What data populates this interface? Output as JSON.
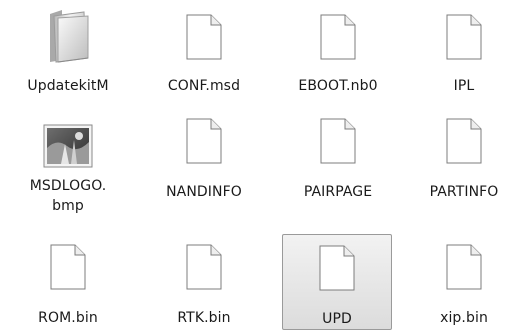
{
  "files": [
    {
      "name": "UpdatekitM",
      "icon": "folder-icon",
      "selected": false
    },
    {
      "name": "CONF.msd",
      "icon": "blank-file-icon",
      "selected": false
    },
    {
      "name": "EBOOT.nb0",
      "icon": "blank-file-icon",
      "selected": false
    },
    {
      "name": "IPL",
      "icon": "blank-file-icon",
      "selected": false
    },
    {
      "name": "MSDLOGO.\nbmp",
      "icon": "bitmap-image-icon",
      "selected": false
    },
    {
      "name": "NANDINFO",
      "icon": "blank-file-icon",
      "selected": false
    },
    {
      "name": "PAIRPAGE",
      "icon": "blank-file-icon",
      "selected": false
    },
    {
      "name": "PARTINFO",
      "icon": "blank-file-icon",
      "selected": false
    },
    {
      "name": "ROM.bin",
      "icon": "blank-file-icon",
      "selected": false
    },
    {
      "name": "RTK.bin",
      "icon": "blank-file-icon",
      "selected": false
    },
    {
      "name": "UPD",
      "icon": "blank-file-icon",
      "selected": true
    },
    {
      "name": "xip.bin",
      "icon": "blank-file-icon",
      "selected": false
    }
  ]
}
